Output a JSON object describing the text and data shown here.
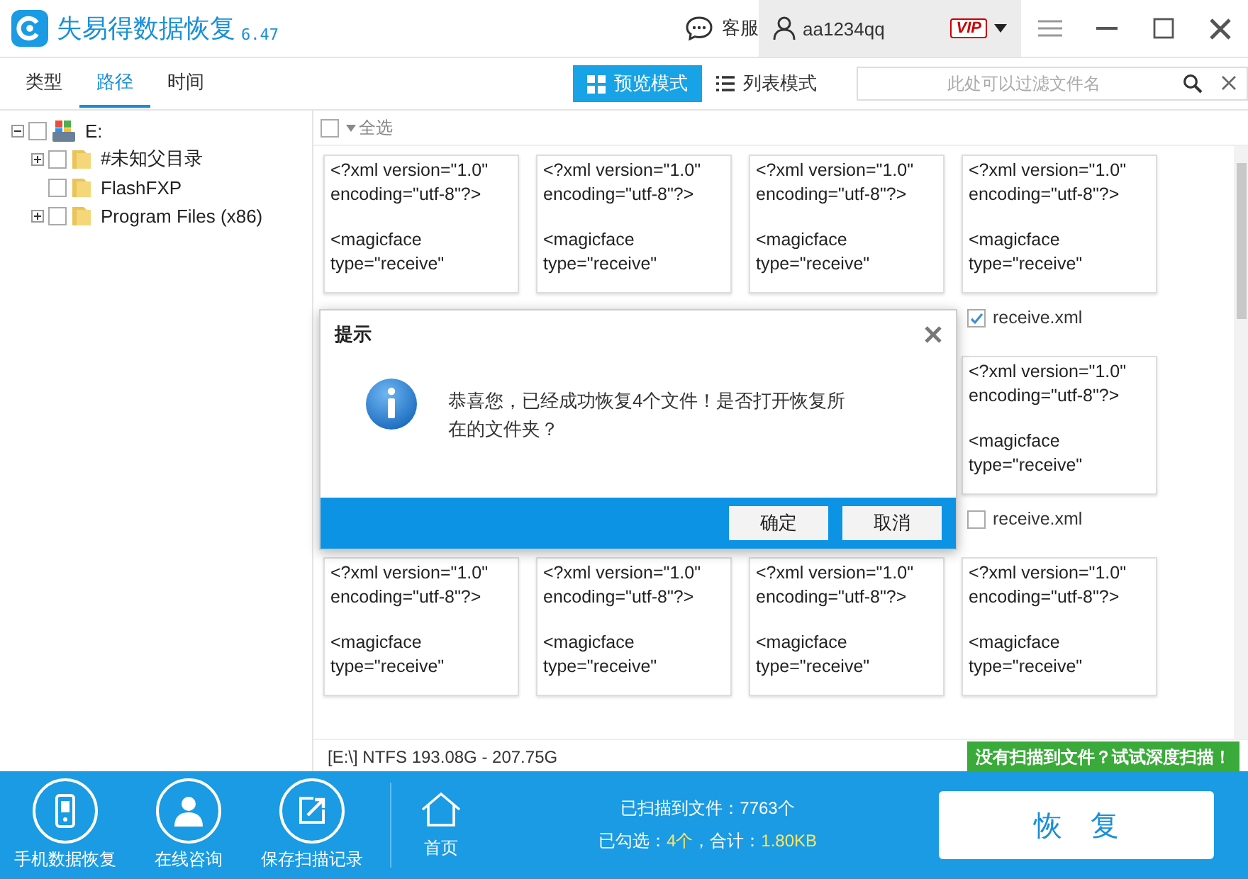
{
  "app": {
    "title": "失易得数据恢复",
    "version": "6.47",
    "support": "客服",
    "user": "aa1234qq",
    "badge": "VIP"
  },
  "tabs": [
    {
      "label": "类型",
      "selected": false
    },
    {
      "label": "路径",
      "selected": true
    },
    {
      "label": "时间",
      "selected": false
    }
  ],
  "view_modes": [
    {
      "label": "预览模式",
      "selected": true,
      "kind": "grid"
    },
    {
      "label": "列表模式",
      "selected": false,
      "kind": "list"
    }
  ],
  "filter": {
    "placeholder": "此处可以过滤文件名"
  },
  "tree": [
    {
      "label": "E:",
      "kind": "drive",
      "checked": false,
      "expanded": true,
      "children": [
        {
          "label": "#未知父目录",
          "kind": "folder",
          "checked": false,
          "expanded": false
        },
        {
          "label": "FlashFXP",
          "kind": "folder",
          "checked": false
        },
        {
          "label": "Program Files (x86)",
          "kind": "folder",
          "checked": false,
          "expanded": false
        }
      ]
    }
  ],
  "select_all": {
    "label": "全选",
    "checked": false
  },
  "files": [
    {
      "kind": "file",
      "preview": [
        "<?xml version=\"1.0\"\nencoding=\"utf-8\"?>",
        "<magicface\ntype=\"receive\""
      ]
    },
    {
      "kind": "file",
      "preview": [
        "<?xml version=\"1.0\"\nencoding=\"utf-8\"?>",
        "<magicface\ntype=\"receive\""
      ]
    },
    {
      "kind": "file",
      "preview": [
        "<?xml version=\"1.0\"\nencoding=\"utf-8\"?>",
        "<magicface\ntype=\"receive\""
      ]
    },
    {
      "kind": "file",
      "preview": [
        "<?xml version=\"1.0\"\nencoding=\"utf-8\"?>",
        "<magicface\ntype=\"receive\""
      ],
      "name": "receive.xml",
      "checked": true
    },
    {
      "kind": "hidden"
    },
    {
      "kind": "hidden"
    },
    {
      "kind": "hidden"
    },
    {
      "kind": "file",
      "preview": [
        "<?xml version=\"1.0\"\nencoding=\"utf-8\"?>",
        "<magicface\ntype=\"receive\""
      ],
      "name": "receive.xml",
      "checked": false
    },
    {
      "kind": "file",
      "preview": [
        "<?xml version=\"1.0\"\nencoding=\"utf-8\"?>",
        "<magicface\ntype=\"receive\""
      ]
    },
    {
      "kind": "file",
      "preview": [
        "<?xml version=\"1.0\"\nencoding=\"utf-8\"?>",
        "<magicface\ntype=\"receive\""
      ]
    },
    {
      "kind": "file",
      "preview": [
        "<?xml version=\"1.0\"\nencoding=\"utf-8\"?>",
        "<magicface\ntype=\"receive\""
      ]
    },
    {
      "kind": "file",
      "preview": [
        "<?xml version=\"1.0\"\nencoding=\"utf-8\"?>",
        "<magicface\ntype=\"receive\""
      ]
    }
  ],
  "status": {
    "disk": "[E:\\] NTFS 193.08G - 207.75G",
    "deep_scan": "没有扫描到文件？试试深度扫描！"
  },
  "dialog": {
    "title": "提示",
    "message": "恭喜您，已经成功恢复4个文件！是否打开恢复所在的文件夹？",
    "buttons": [
      "确定",
      "取消"
    ]
  },
  "footer": {
    "actions": [
      {
        "label": "手机数据恢复",
        "kind": "phone"
      },
      {
        "label": "在线咨询",
        "kind": "person"
      },
      {
        "label": "保存扫描记录",
        "kind": "export"
      }
    ],
    "home": "首页",
    "stats": [
      [
        {
          "text": "已扫描到文件：7763个",
          "highlight": false
        }
      ],
      [
        {
          "text": "已勾选：",
          "highlight": false
        },
        {
          "text": "4个",
          "highlight": true
        },
        {
          "text": "，合计：",
          "highlight": false
        },
        {
          "text": "1.80KB",
          "highlight": true
        }
      ]
    ],
    "recover": "恢　复"
  }
}
